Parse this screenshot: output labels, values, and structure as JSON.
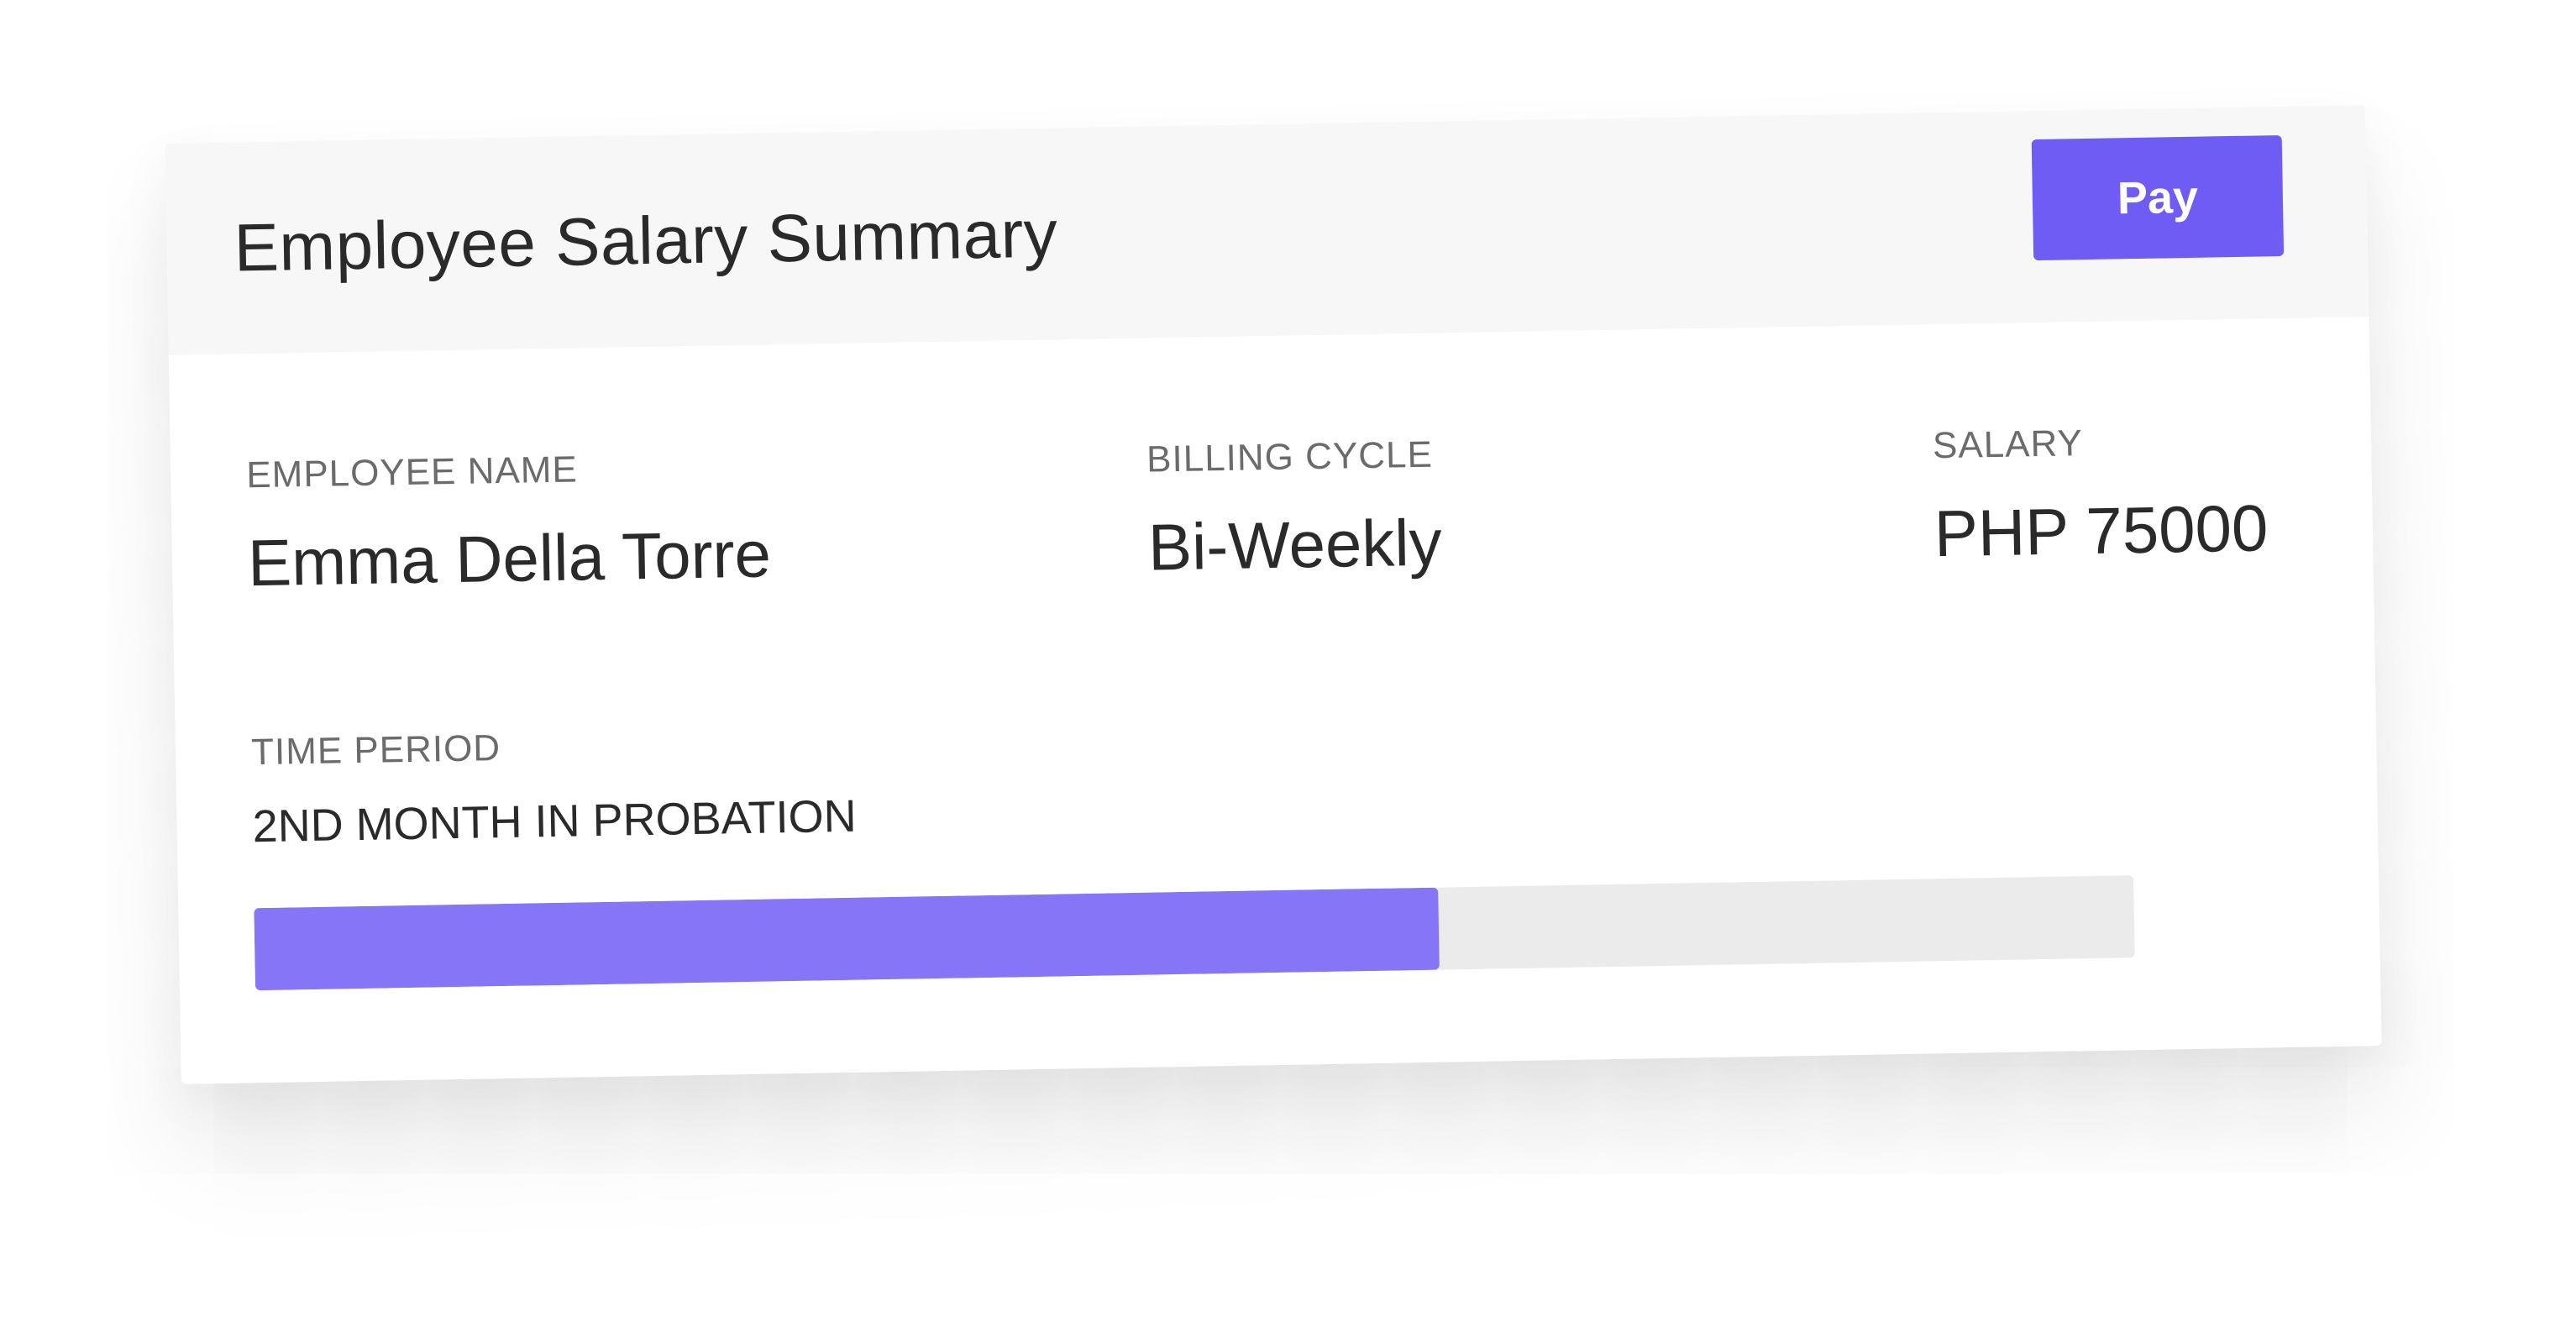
{
  "card": {
    "title": "Employee Salary Summary",
    "pay_label": "Pay"
  },
  "fields": {
    "employee_name_label": "EMPLOYEE NAME",
    "employee_name_value": "Emma Della Torre",
    "billing_cycle_label": "BILLING CYCLE",
    "billing_cycle_value": "Bi-Weekly",
    "salary_label": "SALARY",
    "salary_value": "PHP 75000",
    "time_period_label": "TIME PERIOD",
    "time_period_value": "2ND MONTH IN PROBATION"
  },
  "progress": {
    "fraction": 0.63
  },
  "colors": {
    "accent": "#6e5cf5",
    "progress_fill": "#8676f7",
    "progress_track": "#ebebeb",
    "header_bg": "#f7f7f7",
    "text_dark": "#2a2a2a",
    "text_muted": "#6b6b6b"
  }
}
